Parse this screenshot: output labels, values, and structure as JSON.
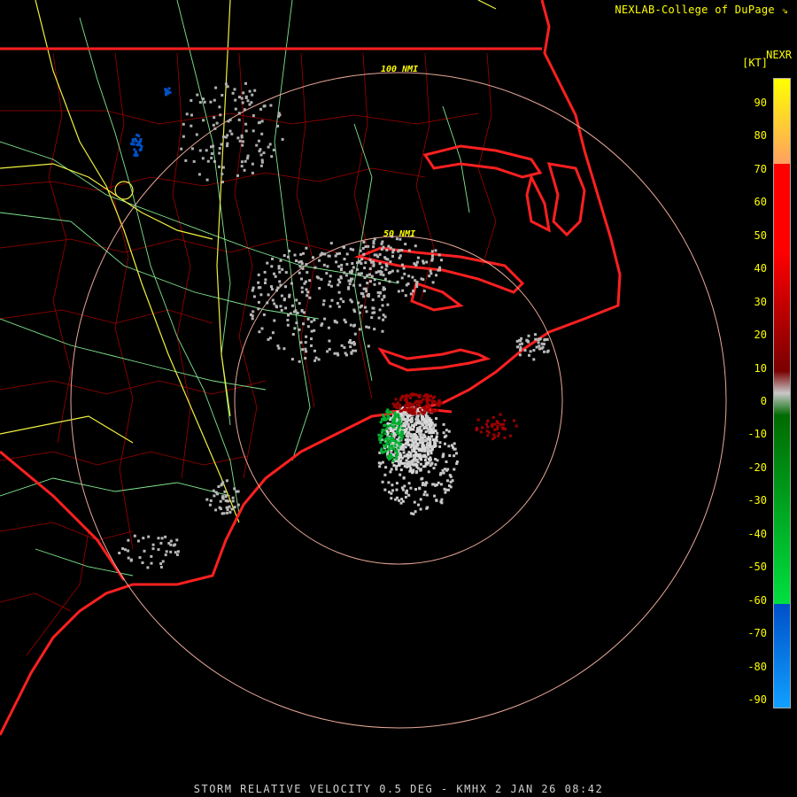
{
  "header": {
    "credit": "NEXLAB-College of DuPage",
    "credit_icon": "arrow-logo-icon",
    "product": "NEXR",
    "units": "[KT]"
  },
  "rings": {
    "inner_label": "50 NMI",
    "outer_label": "100 NMI"
  },
  "legend": {
    "ticks": [
      "90",
      "80",
      "70",
      "60",
      "50",
      "40",
      "30",
      "20",
      "10",
      "0",
      "-10",
      "-20",
      "-30",
      "-40",
      "-50",
      "-60",
      "-70",
      "-80",
      "-90"
    ],
    "colors": {
      "yellow": "#ffff00",
      "orange": "#ffa060",
      "red": "#ff0000",
      "darkred": "#7a0000",
      "gray": "#c8c8c8",
      "darkgreen": "#006a00",
      "green": "#00e040",
      "blue": "#0050c8",
      "lightblue": "#10a0ff"
    }
  },
  "colors": {
    "state_border": "#ff2020",
    "county": "#c00000",
    "highway_major": "#ffff40",
    "highway_minor": "#90f0a0",
    "ring": "#e8a898"
  },
  "caption": "STORM RELATIVE VELOCITY 0.5 DEG - KMHX 2 JAN 26 08:42"
}
